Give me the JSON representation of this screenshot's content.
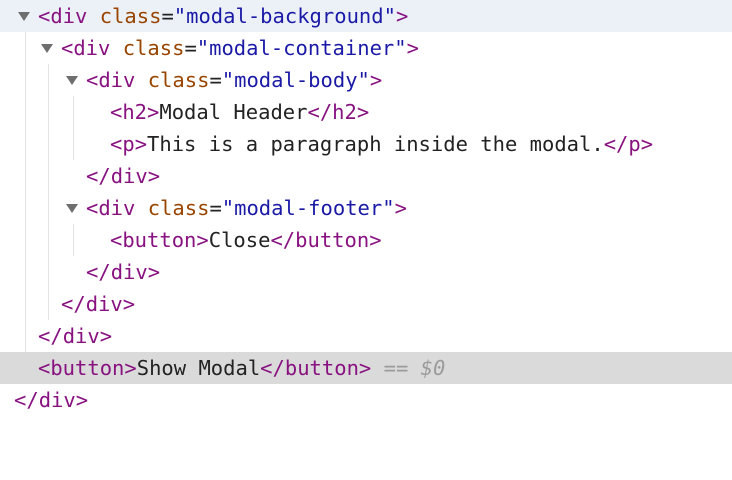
{
  "nodes": [
    {
      "id": "modal-background-open",
      "open": "<",
      "tag": "div",
      "attr": "class",
      "eq": "=",
      "val": "\"modal-background\"",
      "close": ">"
    },
    {
      "id": "modal-container-open",
      "open": "<",
      "tag": "div",
      "attr": "class",
      "eq": "=",
      "val": "\"modal-container\"",
      "close": ">"
    },
    {
      "id": "modal-body-open",
      "open": "<",
      "tag": "div",
      "attr": "class",
      "eq": "=",
      "val": "\"modal-body\"",
      "close": ">"
    },
    {
      "id": "h2",
      "open": "<",
      "tag": "h2",
      "close": ">",
      "text": "Modal Header",
      "end_open": "</",
      "end_tag": "h2",
      "end_close": ">"
    },
    {
      "id": "p",
      "open": "<",
      "tag": "p",
      "close": ">",
      "text": "This is a paragraph inside the modal.",
      "end_open": "</",
      "end_tag": "p",
      "end_close": ">"
    },
    {
      "id": "modal-body-close",
      "end_open": "</",
      "end_tag": "div",
      "end_close": ">"
    },
    {
      "id": "modal-footer-open",
      "open": "<",
      "tag": "div",
      "attr": "class",
      "eq": "=",
      "val": "\"modal-footer\"",
      "close": ">"
    },
    {
      "id": "close-button",
      "open": "<",
      "tag": "button",
      "close": ">",
      "text": "Close",
      "end_open": "</",
      "end_tag": "button",
      "end_close": ">"
    },
    {
      "id": "modal-footer-close",
      "end_open": "</",
      "end_tag": "div",
      "end_close": ">"
    },
    {
      "id": "modal-container-close",
      "end_open": "</",
      "end_tag": "div",
      "end_close": ">"
    },
    {
      "id": "modal-background-close",
      "end_open": "</",
      "end_tag": "div",
      "end_close": ">"
    },
    {
      "id": "show-modal-button",
      "open": "<",
      "tag": "button",
      "close": ">",
      "text": "Show Modal",
      "end_open": "</",
      "end_tag": "button",
      "end_close": ">",
      "eq_marker": "==",
      "ref": "$0"
    },
    {
      "id": "root-close",
      "end_open": "</",
      "end_tag": "div",
      "end_close": ">"
    }
  ],
  "colors": {
    "tag": "#881280",
    "attr_name": "#994500",
    "attr_value": "#1a1aa6",
    "text": "#222222",
    "selected_row": "#dadada",
    "hover_row": "#ecf1f8"
  },
  "icons": {
    "twisty": "triangle-down-icon"
  }
}
